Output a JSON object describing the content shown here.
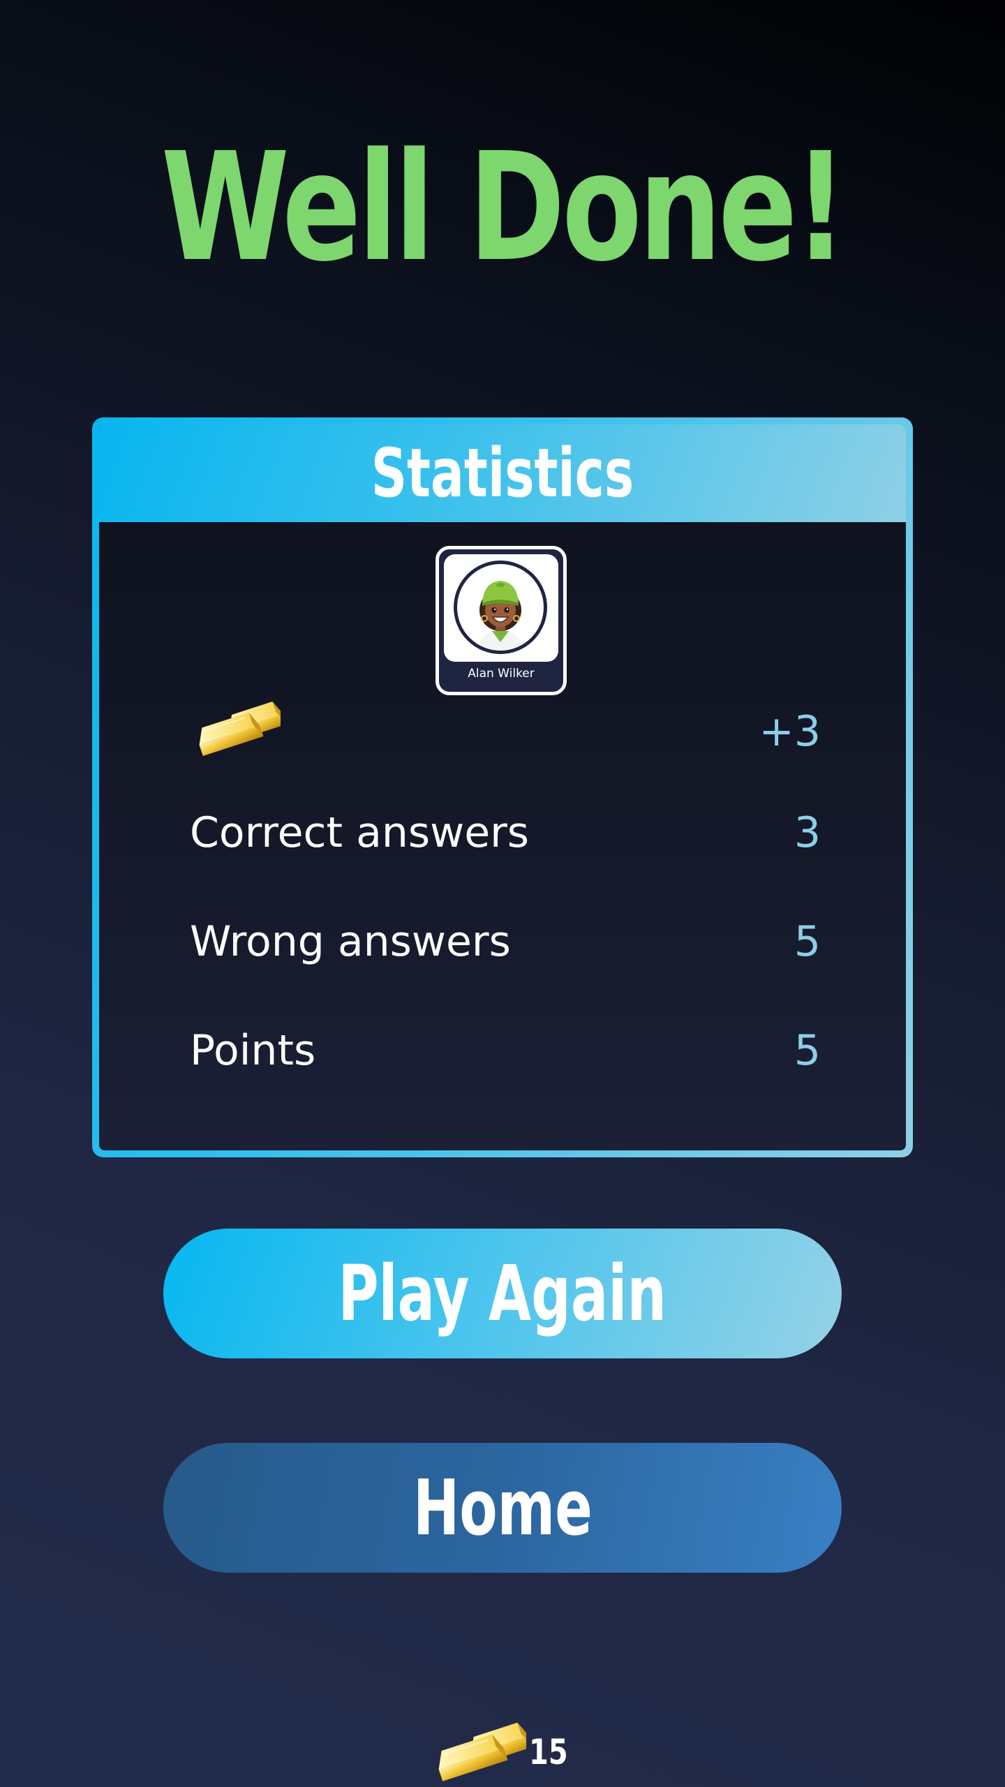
{
  "title": "Well Done!",
  "statistics": {
    "header": "Statistics",
    "player": {
      "name": "Alan Wilker"
    },
    "gold_reward": "+3",
    "rows": [
      {
        "label": "Correct answers",
        "value": "3"
      },
      {
        "label": "Wrong answers",
        "value": "5"
      },
      {
        "label": "Points",
        "value": "5"
      }
    ]
  },
  "buttons": {
    "play_again": "Play Again",
    "home": "Home"
  },
  "footer": {
    "gold_total": "15"
  },
  "icons": {
    "gold": "gold-bars-icon",
    "avatar": "player-avatar"
  },
  "colors": {
    "title_green": "#7ed66f",
    "accent_blue": "#08b6ef",
    "value_blue": "#8bcfe7",
    "home_button": "#2c66a0"
  }
}
